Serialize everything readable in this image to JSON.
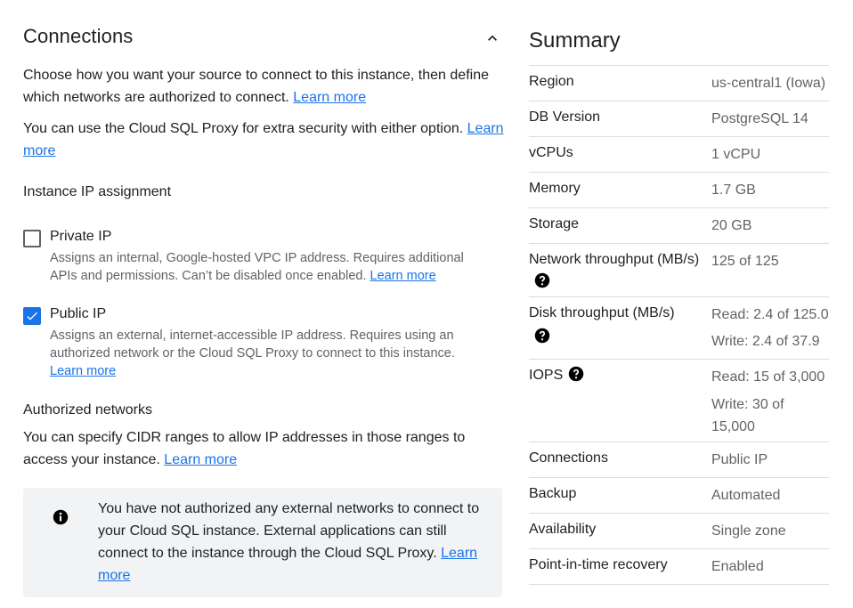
{
  "connections": {
    "title": "Connections",
    "intro_text": "Choose how you want your source to connect to this instance, then define which networks are authorized to connect. ",
    "intro_link": "Learn more",
    "proxy_text": "You can use the Cloud SQL Proxy for extra security with either option. ",
    "proxy_link": "Learn more",
    "ip_heading": "Instance IP assignment",
    "private_ip": {
      "label": "Private IP",
      "checked": false,
      "desc": "Assigns an internal, Google-hosted VPC IP address. Requires additional APIs and permissions. Can’t be disabled once enabled. ",
      "link": "Learn more"
    },
    "public_ip": {
      "label": "Public IP",
      "checked": true,
      "desc": "Assigns an external, internet-accessible IP address. Requires using an authorized network or the Cloud SQL Proxy to connect to this instance. ",
      "link": "Learn more"
    },
    "auth_heading": "Authorized networks",
    "auth_text": "You can specify CIDR ranges to allow IP addresses in those ranges to access your instance. ",
    "auth_link": "Learn more",
    "info_text": "You have not authorized any external networks to connect to your Cloud SQL instance. External applications can still connect to the instance through the Cloud SQL Proxy. ",
    "info_link": "Learn more"
  },
  "summary": {
    "title": "Summary",
    "region_key": "Region",
    "region_val": "us-central1 (Iowa)",
    "db_key": "DB Version",
    "db_val": "PostgreSQL 14",
    "vcpu_key": "vCPUs",
    "vcpu_val": "1 vCPU",
    "memory_key": "Memory",
    "memory_val": "1.7 GB",
    "storage_key": "Storage",
    "storage_val": "20 GB",
    "net_key": "Network throughput (MB/s)",
    "net_val": "125 of 125",
    "disk_key": "Disk throughput (MB/s)",
    "disk_read": "Read: 2.4 of 125.0",
    "disk_write": "Write: 2.4 of 37.9",
    "iops_key": "IOPS",
    "iops_read": "Read: 15 of 3,000",
    "iops_write": "Write: 30 of 15,000",
    "conn_key": "Connections",
    "conn_val": "Public IP",
    "backup_key": "Backup",
    "backup_val": "Automated",
    "avail_key": "Availability",
    "avail_val": "Single zone",
    "pitr_key": "Point-in-time recovery",
    "pitr_val": "Enabled"
  },
  "colors": {
    "accent": "#1a73e8",
    "text": "#202124",
    "muted": "#5f6368",
    "info_bg": "#f1f3f4"
  },
  "icons": {
    "collapse": "chevron-up-icon",
    "info": "info-icon",
    "help": "help-icon",
    "check": "check-icon"
  }
}
